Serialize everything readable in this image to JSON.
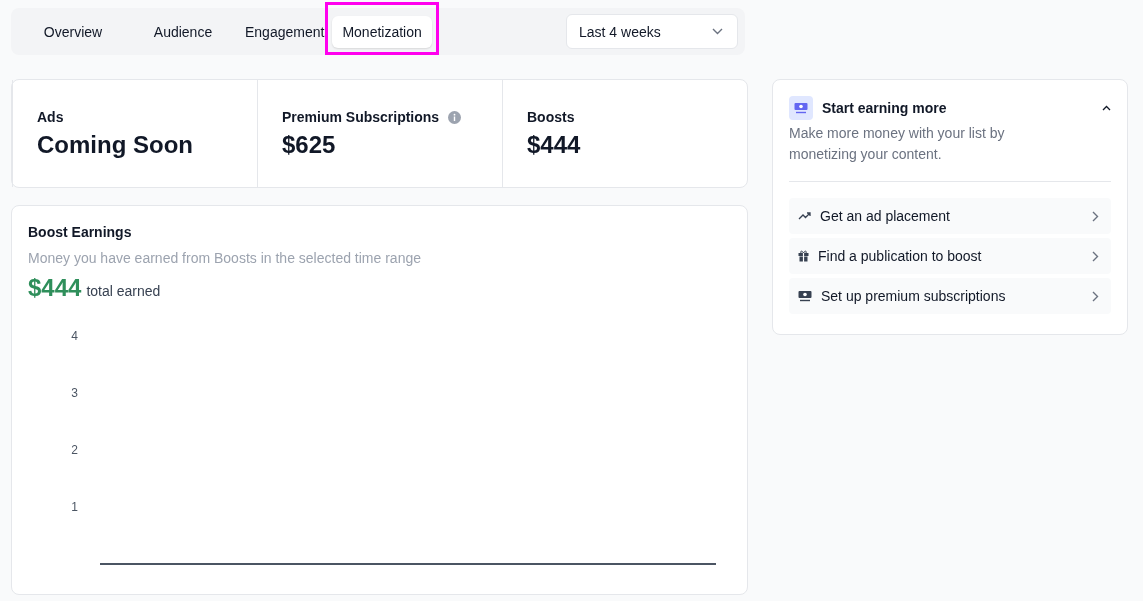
{
  "tabs": [
    {
      "label": "Overview",
      "selected": false
    },
    {
      "label": "Audience",
      "selected": false
    },
    {
      "label": "Engagement",
      "selected": false
    },
    {
      "label": "Monetization",
      "selected": true
    }
  ],
  "range_select": {
    "value": "Last 4 weeks"
  },
  "stats": [
    {
      "label": "Ads",
      "value": "Coming Soon",
      "info": false
    },
    {
      "label": "Premium Subscriptions",
      "value": "$625",
      "info": true
    },
    {
      "label": "Boosts",
      "value": "$444",
      "info": false
    }
  ],
  "boost_earnings": {
    "title": "Boost Earnings",
    "subtitle": "Money you have earned from Boosts in the selected time range",
    "total": "$444",
    "total_label": "total earned",
    "y_axis_ticks": [
      "4",
      "3",
      "2",
      "1"
    ]
  },
  "earn_panel": {
    "title": "Start earning more",
    "expanded": true,
    "description": "Make more money with your list by monetizing your content.",
    "items": [
      {
        "kind": "ad",
        "label": "Get an ad placement"
      },
      {
        "kind": "boost",
        "label": "Find a publication to boost"
      },
      {
        "kind": "premium",
        "label": "Set up premium subscriptions"
      }
    ]
  }
}
